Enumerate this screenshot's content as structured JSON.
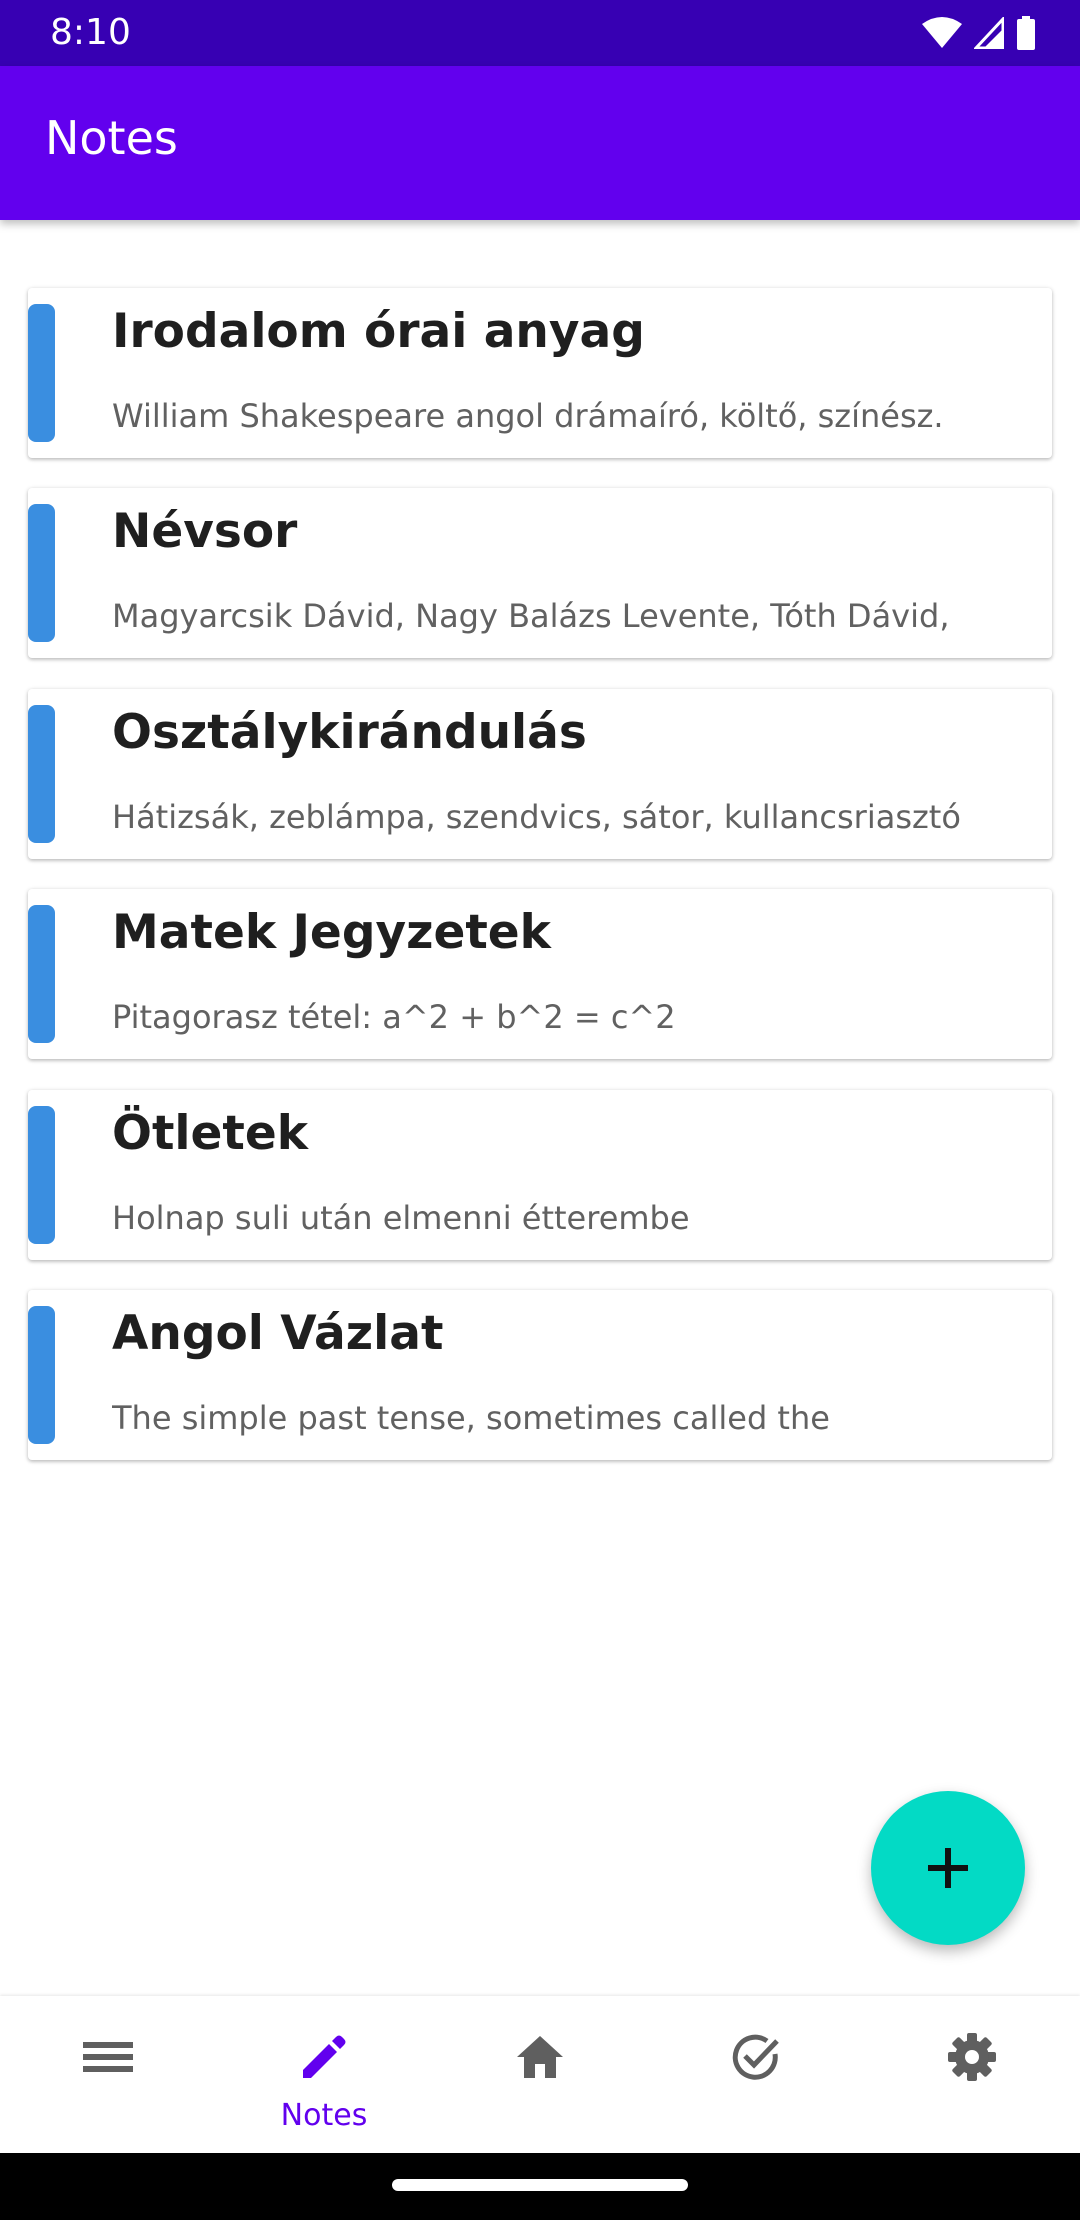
{
  "status_bar": {
    "time": "8:10"
  },
  "app_bar": {
    "title": "Notes"
  },
  "notes": [
    {
      "title": "Irodalom órai anyag",
      "preview": "William Shakespeare angol drámaíró, költő, színész."
    },
    {
      "title": "Névsor",
      "preview": "Magyarcsik Dávid, Nagy Balázs Levente, Tóth Dávid,"
    },
    {
      "title": "Osztálykirándulás",
      "preview": "Hátizsák, zeblámpa, szendvics, sátor, kullancsriasztó"
    },
    {
      "title": "Matek Jegyzetek",
      "preview": "Pitagorasz tétel: a^2 + b^2 = c^2"
    },
    {
      "title": "Ötletek",
      "preview": "Holnap suli után elmenni étterembe"
    },
    {
      "title": "Angol Vázlat",
      "preview": "The simple past tense, sometimes called the"
    }
  ],
  "fab": {
    "icon": "plus-icon"
  },
  "bottom_nav": {
    "items": [
      {
        "icon": "menu-icon",
        "label": ""
      },
      {
        "icon": "pencil-icon",
        "label": "Notes",
        "active": true
      },
      {
        "icon": "home-icon",
        "label": ""
      },
      {
        "icon": "check-circle-icon",
        "label": ""
      },
      {
        "icon": "gear-icon",
        "label": ""
      }
    ]
  },
  "colors": {
    "status_bar": "#3700b3",
    "primary": "#6200ee",
    "accent": "#03dac5",
    "note_accent": "#3a8ee0",
    "nav_icon": "#5f5f5f"
  }
}
